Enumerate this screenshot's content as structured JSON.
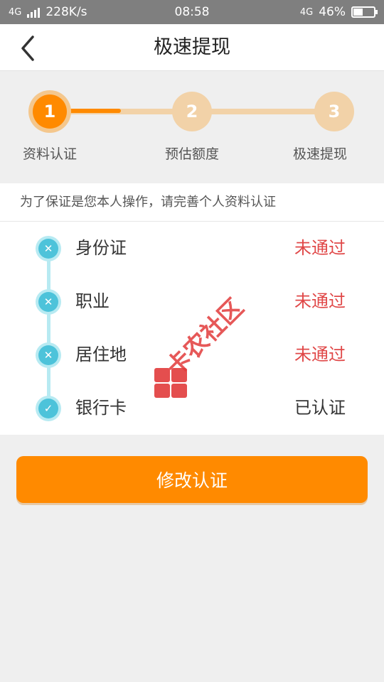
{
  "status_bar": {
    "network_left": "4G",
    "speed": "228K/s",
    "time": "08:58",
    "network_right": "4G",
    "battery": "46%",
    "battery_level": 0.46
  },
  "nav": {
    "title": "极速提现",
    "back_icon": "chevron-left-icon"
  },
  "steps": [
    {
      "number": "1",
      "label": "资料认证",
      "state": "current"
    },
    {
      "number": "2",
      "label": "预估额度",
      "state": "todo"
    },
    {
      "number": "3",
      "label": "极速提现",
      "state": "todo"
    }
  ],
  "step_progress": 0.25,
  "tip": "为了保证是您本人操作，请完善个人资料认证",
  "verification_items": [
    {
      "label": "身份证",
      "status": "未通过",
      "result": "fail",
      "icon": "x-circle-icon"
    },
    {
      "label": "职业",
      "status": "未通过",
      "result": "fail",
      "icon": "x-circle-icon"
    },
    {
      "label": "居住地",
      "status": "未通过",
      "result": "fail",
      "icon": "x-circle-icon"
    },
    {
      "label": "银行卡",
      "status": "已认证",
      "result": "ok",
      "icon": "check-circle-icon"
    }
  ],
  "primary_button": "修改认证",
  "watermark_text": "卡农社区",
  "colors": {
    "accent": "#ff8a00",
    "accent_light": "#f2d2a8",
    "fail": "#e04848",
    "timeline": "#4dc3da"
  }
}
